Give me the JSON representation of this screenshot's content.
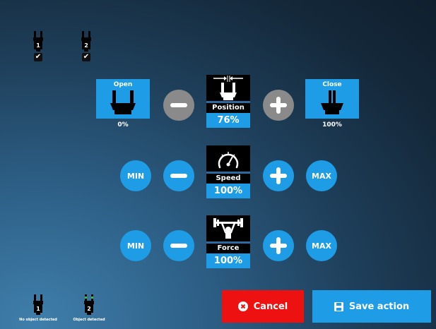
{
  "grippers": [
    {
      "number": "1",
      "checked_mark": "✔"
    },
    {
      "number": "2",
      "checked_mark": "✔"
    }
  ],
  "position": {
    "open_label": "Open",
    "open_percent": "0%",
    "close_label": "Close",
    "close_percent": "100%",
    "name": "Position",
    "value": "76%"
  },
  "speed": {
    "min_label": "MIN",
    "max_label": "MAX",
    "name": "Speed",
    "value": "100%"
  },
  "force": {
    "min_label": "MIN",
    "max_label": "MAX",
    "name": "Force",
    "value": "100%"
  },
  "actions": {
    "cancel_label": "Cancel",
    "save_label": "Save action"
  },
  "status": [
    {
      "number": "1",
      "text": "No object detected"
    },
    {
      "number": "2",
      "text": "Object detected"
    }
  ],
  "colors": {
    "accent": "#1e9de6",
    "cancel": "#ee1111",
    "disabled": "#8a8a8a",
    "detected": "#3dbb3d"
  },
  "icons": [
    "gripper-icon",
    "checkbox-icon",
    "minus-icon",
    "plus-icon",
    "gauge-icon",
    "weightlifter-icon",
    "cancel-icon",
    "save-icon"
  ]
}
